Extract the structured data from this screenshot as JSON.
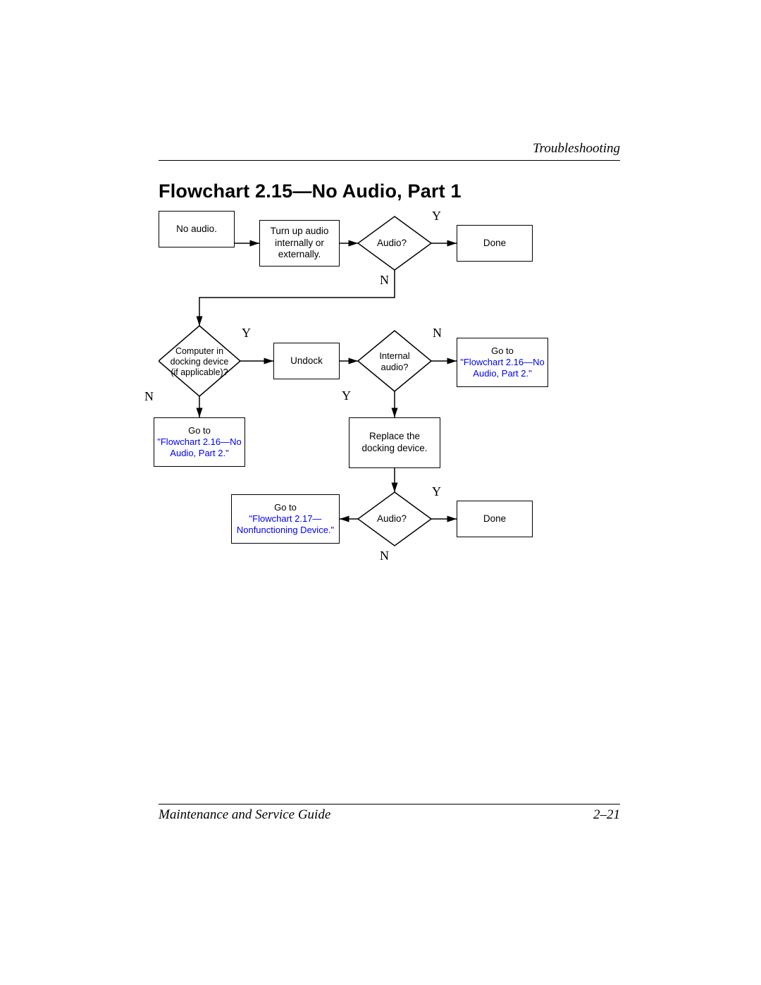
{
  "header": {
    "section": "Troubleshooting"
  },
  "title": "Flowchart 2.15—No Audio, Part 1",
  "labels": {
    "Y": "Y",
    "N": "N"
  },
  "nodes": {
    "no_audio": "No audio.",
    "turn_up": "Turn up audio internally or externally.",
    "audio1": "Audio?",
    "done1": "Done",
    "docking_q": "Computer in docking device (if applicable)?",
    "undock": "Undock",
    "internal_audio": "Internal audio?",
    "goto_216a_pre": "Go to ",
    "goto_216a_link": "\"Flowchart 2.16—No Audio, Part 2.\"",
    "goto_216b_pre": "Go to ",
    "goto_216b_link": "\"Flowchart 2.16—No Audio, Part 2.\"",
    "replace_dock": "Replace the docking device.",
    "goto_217_pre": "Go to ",
    "goto_217_link": "\"Flowchart 2.17—Nonfunctioning Device.\"",
    "audio2": "Audio?",
    "done2": "Done"
  },
  "footer": {
    "left": "Maintenance and Service Guide",
    "right": "2–21"
  }
}
